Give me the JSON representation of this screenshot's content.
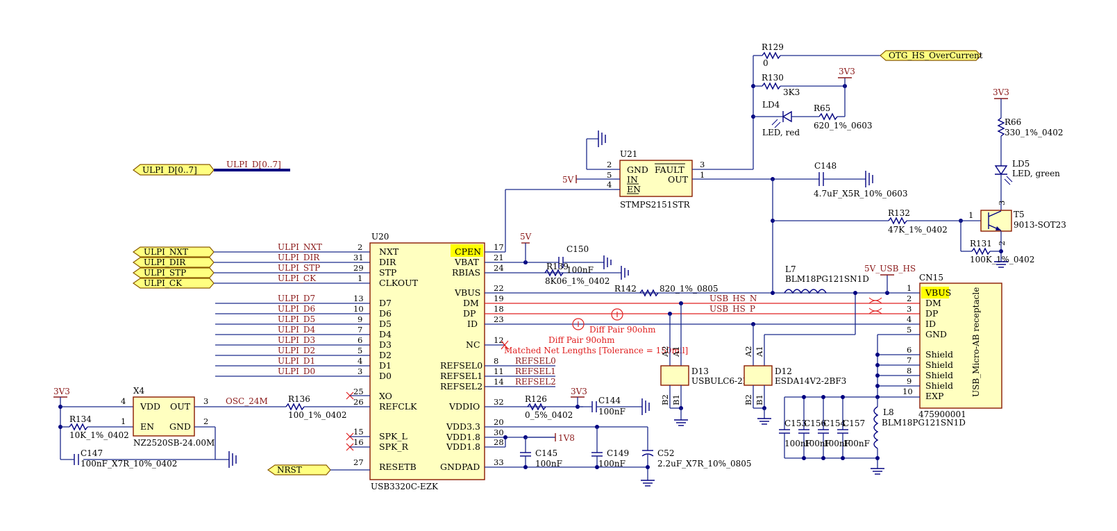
{
  "ports": {
    "ulpi_d": "ULPI_D[0..7]",
    "ulpi_nxt": "ULPI_NXT",
    "ulpi_dir": "ULPI_DIR",
    "ulpi_stp": "ULPI_STP",
    "ulpi_ck": "ULPI_CK",
    "nrst": "NRST",
    "otg_hs_overcurrent": "OTG_HS_OverCurrent"
  },
  "nets": {
    "ulpi_d_bus": "ULPI_D[0..7]",
    "ulpi_nxt": "ULPI_NXT",
    "ulpi_dir": "ULPI_DIR",
    "ulpi_stp": "ULPI_STP",
    "ulpi_ck": "ULPI_CK",
    "ulpi_d7": "ULPI_D7",
    "ulpi_d6": "ULPI_D6",
    "ulpi_d5": "ULPI_D5",
    "ulpi_d4": "ULPI_D4",
    "ulpi_d3": "ULPI_D3",
    "ulpi_d2": "ULPI_D2",
    "ulpi_d1": "ULPI_D1",
    "ulpi_d0": "ULPI_D0",
    "osc_24m": "OSC_24M",
    "usb_hs_n": "USB_HS_N",
    "usb_hs_p": "USB_HS_P",
    "refsel0": "REFSEL0",
    "refsel1": "REFSEL1",
    "refsel2": "REFSEL2"
  },
  "power": {
    "v3v3": "3V3",
    "v5v": "5V",
    "v1v8": "1V8",
    "v5v_usb_hs": "5V_USB_HS"
  },
  "u20": {
    "ref": "U20",
    "part": "USB3320C-EZK",
    "left_pins": [
      {
        "name": "NXT",
        "num": "2"
      },
      {
        "name": "DIR",
        "num": "31"
      },
      {
        "name": "STP",
        "num": "29"
      },
      {
        "name": "CLKOUT",
        "num": "1"
      },
      {
        "name": "D7",
        "num": "13"
      },
      {
        "name": "D6",
        "num": "10"
      },
      {
        "name": "D5",
        "num": "9"
      },
      {
        "name": "D4",
        "num": "7"
      },
      {
        "name": "D3",
        "num": "6"
      },
      {
        "name": "D2",
        "num": "5"
      },
      {
        "name": "D1",
        "num": "4"
      },
      {
        "name": "D0",
        "num": "3"
      },
      {
        "name": "XO",
        "num": "25"
      },
      {
        "name": "REFCLK",
        "num": "26"
      },
      {
        "name": "SPK_L",
        "num": "15"
      },
      {
        "name": "SPK_R",
        "num": "16"
      },
      {
        "name": "RESETB",
        "num": "27"
      }
    ],
    "right_pins": [
      {
        "name": "CPEN",
        "num": "17"
      },
      {
        "name": "VBAT",
        "num": "21"
      },
      {
        "name": "RBIAS",
        "num": "24"
      },
      {
        "name": "VBUS",
        "num": "22"
      },
      {
        "name": "DM",
        "num": "19"
      },
      {
        "name": "DP",
        "num": "18"
      },
      {
        "name": "ID",
        "num": "23"
      },
      {
        "name": "NC",
        "num": "12"
      },
      {
        "name": "REFSEL0",
        "num": "8"
      },
      {
        "name": "REFSEL1",
        "num": "11"
      },
      {
        "name": "REFSEL2",
        "num": "14"
      },
      {
        "name": "VDDIO",
        "num": "32"
      },
      {
        "name": "VDD3.3",
        "num": "20"
      },
      {
        "name": "VDD1.8",
        "num": "30"
      },
      {
        "name": "VDD1.8",
        "num": "28"
      },
      {
        "name": "GNDPAD",
        "num": "33"
      }
    ]
  },
  "u21": {
    "ref": "U21",
    "part": "STMPS2151STR",
    "pins": [
      {
        "name": "GND",
        "num": "2"
      },
      {
        "name": "IN",
        "num": "5"
      },
      {
        "name": "EN",
        "num": "4"
      },
      {
        "name": "FAULT",
        "num": "3"
      },
      {
        "name": "OUT",
        "num": "1"
      }
    ]
  },
  "x4": {
    "ref": "X4",
    "part": "NZ2520SB-24.00M",
    "pins": [
      {
        "name": "VDD",
        "num": "4"
      },
      {
        "name": "OUT",
        "num": "3"
      },
      {
        "name": "EN",
        "num": "1"
      },
      {
        "name": "GND",
        "num": "2"
      }
    ]
  },
  "cn15": {
    "ref": "CN15",
    "part": "475900001",
    "body_label": "USB_Micro-AB receptacle",
    "pins": [
      {
        "name": "VBUS",
        "num": "1"
      },
      {
        "name": "DM",
        "num": "2"
      },
      {
        "name": "DP",
        "num": "3"
      },
      {
        "name": "ID",
        "num": "4"
      },
      {
        "name": "GND",
        "num": "5"
      },
      {
        "name": "Shield",
        "num": "6"
      },
      {
        "name": "Shield",
        "num": "7"
      },
      {
        "name": "Shield",
        "num": "8"
      },
      {
        "name": "Shield",
        "num": "9"
      },
      {
        "name": "EXP",
        "num": "10"
      }
    ]
  },
  "t5": {
    "ref": "T5",
    "part": "9013-SOT23",
    "pin1": "1",
    "pin2": "2",
    "pin3": "3"
  },
  "d13": {
    "ref": "D13",
    "part": "USBULC6-2F",
    "a1": "A1",
    "a2": "A2",
    "b1": "B1",
    "b2": "B2"
  },
  "d12": {
    "ref": "D12",
    "part": "ESDA14V2-2BF3",
    "a1": "A1",
    "a2": "A2",
    "b1": "B1",
    "b2": "B2"
  },
  "resistors": {
    "r129": {
      "ref": "R129",
      "value": "0"
    },
    "r130": {
      "ref": "R130",
      "value": "3K3"
    },
    "r65": {
      "ref": "R65",
      "value": "620_1%_0603"
    },
    "r66": {
      "ref": "R66",
      "value": "330_1%_0402"
    },
    "r132": {
      "ref": "R132",
      "value": "47K_1%_0402"
    },
    "r131": {
      "ref": "R131",
      "value": "100K_1%_0402"
    },
    "r139": {
      "ref": "R139",
      "value": "8K06_1%_0402"
    },
    "r142": {
      "ref": "R142",
      "value": "820_1%_0805"
    },
    "r136": {
      "ref": "R136",
      "value": "100_1%_0402"
    },
    "r126": {
      "ref": "R126",
      "value": "0_5%_0402"
    },
    "r134": {
      "ref": "R134",
      "value": "10K_1%_0402"
    }
  },
  "capacitors": {
    "c148": {
      "ref": "C148",
      "value": "4.7uF_X5R_10%_0603"
    },
    "c150": {
      "ref": "C150",
      "value": "100nF"
    },
    "c144": {
      "ref": "C144",
      "value": "100nF"
    },
    "c145": {
      "ref": "C145",
      "value": "100nF"
    },
    "c149": {
      "ref": "C149",
      "value": "100nF"
    },
    "c52": {
      "ref": "C52",
      "value": "2.2uF_X7R_10%_0805"
    },
    "c147": {
      "ref": "C147",
      "value": "100nF_X7R_10%_0402"
    },
    "c153": {
      "ref": "C153",
      "value": "100nF"
    },
    "c156": {
      "ref": "C156",
      "value": "100nF"
    },
    "c154": {
      "ref": "C154",
      "value": "100nF"
    },
    "c157": {
      "ref": "C157",
      "value": "100nF"
    }
  },
  "inductors": {
    "l7": {
      "ref": "L7",
      "value": "BLM18PG121SN1D"
    },
    "l8": {
      "ref": "L8",
      "value": "BLM18PG121SN1D"
    }
  },
  "leds": {
    "ld4": {
      "ref": "LD4",
      "value": "LED, red"
    },
    "ld5": {
      "ref": "LD5",
      "value": "LED, green"
    }
  },
  "annotations": {
    "diff_pair_1": "Diff Pair 90ohm",
    "diff_pair_2": "Diff Pair 90ohm",
    "matched_lengths": "Matched Net Lengths [Tolerance = 150mil]"
  },
  "colors": {
    "wire": "#1b2a8c",
    "component_body": "#ffffc0",
    "net_label": "#8b1a1a",
    "annotation": "#e02020",
    "highlight": "#ffff00"
  }
}
